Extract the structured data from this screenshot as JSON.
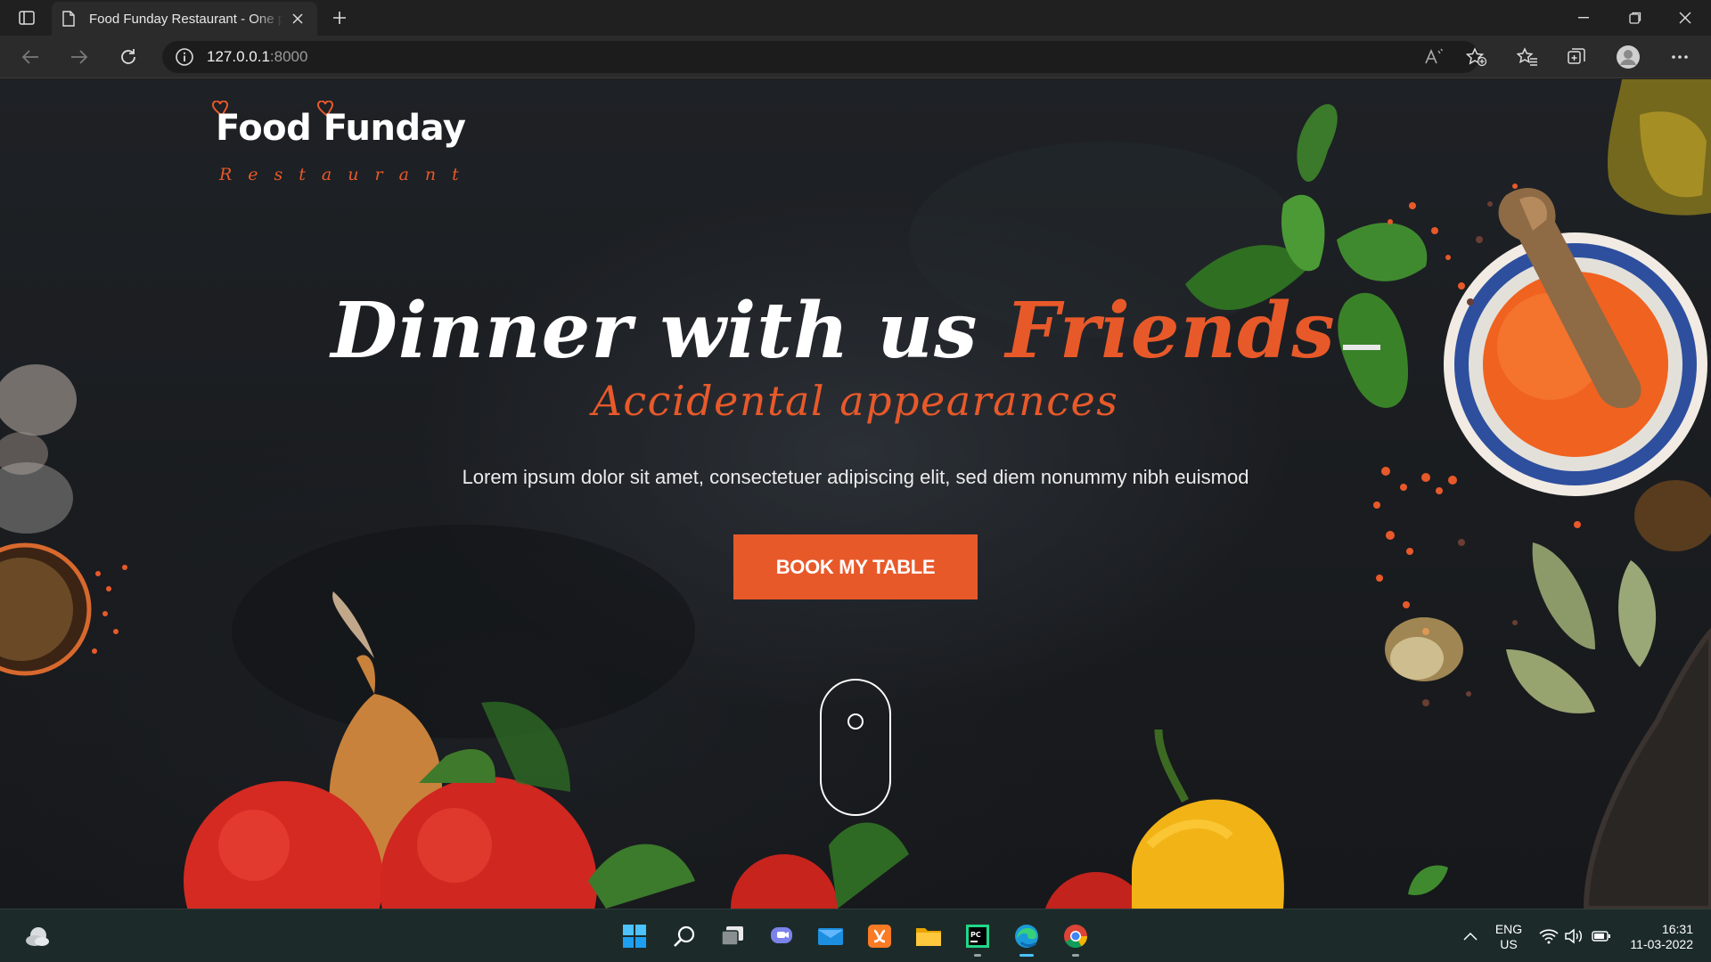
{
  "browser": {
    "tab_title": "Food Funday Restaurant - One p",
    "url_host": "127.0.0.1",
    "url_port": ":8000"
  },
  "site": {
    "logo_word": "Food Funday",
    "logo_sub": "Restaurant",
    "headline_main": "Dinner with us ",
    "headline_accent": "Friends",
    "subheadline": "Accidental appearances",
    "lead": "Lorem ipsum dolor sit amet, consectetuer adipiscing elit, sed diem nonummy nibh euismod",
    "cta_label": "BOOK MY TABLE",
    "accent_color": "#e8592a"
  },
  "taskbar": {
    "lang_primary": "ENG",
    "lang_secondary": "US",
    "time": "16:31",
    "date": "11-03-2022",
    "apps": [
      "start-icon",
      "search-icon",
      "task-view-icon",
      "chat-icon",
      "mail-icon",
      "xampp-icon",
      "file-explorer-icon",
      "pycharm-icon",
      "edge-icon",
      "chrome-icon"
    ]
  }
}
